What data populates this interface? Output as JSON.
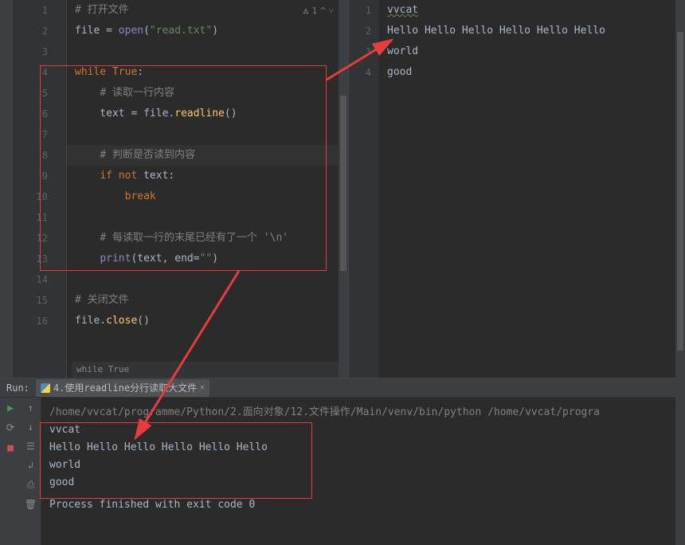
{
  "editor": {
    "warning": {
      "count": "1"
    },
    "lines": [
      {
        "n": "1",
        "tokens": [
          {
            "c": "cm",
            "t": "# 打开文件"
          }
        ]
      },
      {
        "n": "2",
        "tokens": [
          {
            "c": "",
            "t": "file "
          },
          {
            "c": "op",
            "t": "= "
          },
          {
            "c": "bi",
            "t": "open"
          },
          {
            "c": "op",
            "t": "("
          },
          {
            "c": "str",
            "t": "\"read.txt\""
          },
          {
            "c": "op",
            "t": ")"
          }
        ]
      },
      {
        "n": "3",
        "tokens": []
      },
      {
        "n": "4",
        "tokens": [
          {
            "c": "kw",
            "t": "while "
          },
          {
            "c": "kw",
            "t": "True"
          },
          {
            "c": "op",
            "t": ":"
          }
        ]
      },
      {
        "n": "5",
        "tokens": [
          {
            "c": "",
            "t": "    "
          },
          {
            "c": "cm",
            "t": "# 读取一行内容"
          }
        ]
      },
      {
        "n": "6",
        "tokens": [
          {
            "c": "",
            "t": "    text "
          },
          {
            "c": "op",
            "t": "= "
          },
          {
            "c": "",
            "t": "file."
          },
          {
            "c": "fn",
            "t": "readline"
          },
          {
            "c": "op",
            "t": "()"
          }
        ]
      },
      {
        "n": "7",
        "tokens": []
      },
      {
        "n": "8",
        "tokens": [
          {
            "c": "",
            "t": "    "
          },
          {
            "c": "cm",
            "t": "# 判断是否读到内容"
          }
        ]
      },
      {
        "n": "9",
        "tokens": [
          {
            "c": "",
            "t": "    "
          },
          {
            "c": "kw",
            "t": "if not "
          },
          {
            "c": "",
            "t": "text"
          },
          {
            "c": "op",
            "t": ":"
          }
        ]
      },
      {
        "n": "10",
        "tokens": [
          {
            "c": "",
            "t": "        "
          },
          {
            "c": "kw",
            "t": "break"
          }
        ]
      },
      {
        "n": "11",
        "tokens": []
      },
      {
        "n": "12",
        "tokens": [
          {
            "c": "",
            "t": "    "
          },
          {
            "c": "cm",
            "t": "# 每读取一行的末尾已经有了一个 '\\n'"
          }
        ]
      },
      {
        "n": "13",
        "tokens": [
          {
            "c": "",
            "t": "    "
          },
          {
            "c": "bi",
            "t": "print"
          },
          {
            "c": "op",
            "t": "("
          },
          {
            "c": "",
            "t": "text"
          },
          {
            "c": "op",
            "t": ", "
          },
          {
            "c": "",
            "t": "end"
          },
          {
            "c": "op",
            "t": "="
          },
          {
            "c": "str",
            "t": "\"\""
          },
          {
            "c": "op",
            "t": ")"
          }
        ]
      },
      {
        "n": "14",
        "tokens": []
      },
      {
        "n": "15",
        "tokens": [
          {
            "c": "cm",
            "t": "# 关闭文件"
          }
        ]
      },
      {
        "n": "16",
        "tokens": [
          {
            "c": "",
            "t": "file."
          },
          {
            "c": "fn",
            "t": "close"
          },
          {
            "c": "op",
            "t": "()"
          }
        ]
      }
    ],
    "breadcrumb": "while True"
  },
  "rightFile": {
    "lines": [
      {
        "n": "1",
        "text": "vvcat",
        "wavy": true
      },
      {
        "n": "2",
        "text": "Hello Hello Hello Hello Hello Hello"
      },
      {
        "n": "3",
        "text": "world"
      },
      {
        "n": "4",
        "text": "good"
      }
    ]
  },
  "run": {
    "label": "Run:",
    "tabName": "4.使用readline分行读取大文件",
    "output": {
      "command": "/home/vvcat/programme/Python/2.面向对象/12.文件操作/Main/venv/bin/python /home/vvcat/progra",
      "lines": [
        "vvcat",
        "Hello Hello Hello Hello Hello Hello",
        "world",
        "good"
      ],
      "exit": "Process finished with exit code 0"
    }
  }
}
